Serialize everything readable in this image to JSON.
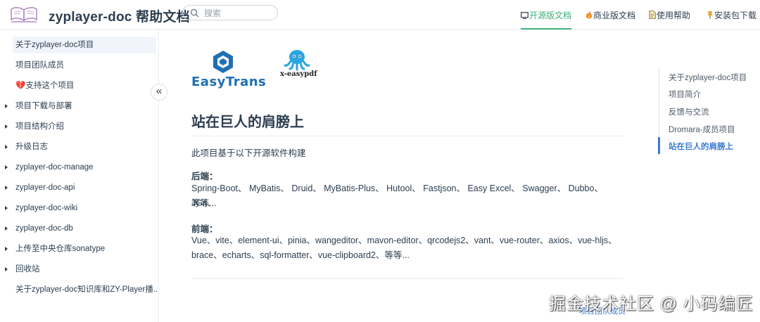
{
  "header": {
    "title": "zyplayer-doc 帮助文档",
    "search_placeholder": "搜索",
    "nav": [
      {
        "icon": "monitor-icon",
        "label": "开源版文档",
        "active": true
      },
      {
        "icon": "fire-icon",
        "label": "商业版文档",
        "active": false
      },
      {
        "icon": "document-icon",
        "label": "使用帮助",
        "active": false
      },
      {
        "icon": "pin-icon",
        "label": "安装包下载",
        "active": false
      }
    ]
  },
  "sidebar": {
    "items": [
      {
        "label": "关于zyplayer-doc项目",
        "active": true,
        "has_children": false
      },
      {
        "label": "项目团队成员",
        "active": false,
        "has_children": false
      },
      {
        "label": "💔支持这个项目",
        "active": false,
        "has_children": false
      },
      {
        "label": "项目下载与部署",
        "active": false,
        "has_children": true
      },
      {
        "label": "项目结构介绍",
        "active": false,
        "has_children": true
      },
      {
        "label": "升级日志",
        "active": false,
        "has_children": true
      },
      {
        "label": "zyplayer-doc-manage",
        "active": false,
        "has_children": true
      },
      {
        "label": "zyplayer-doc-api",
        "active": false,
        "has_children": true
      },
      {
        "label": "zyplayer-doc-wiki",
        "active": false,
        "has_children": true
      },
      {
        "label": "zyplayer-doc-db",
        "active": false,
        "has_children": true
      },
      {
        "label": "上传至中央仓库sonatype",
        "active": false,
        "has_children": true
      },
      {
        "label": "回收站",
        "active": false,
        "has_children": true
      },
      {
        "label": "关于zyplayer-doc知识库和ZY-Player播...",
        "active": false,
        "has_children": false
      }
    ],
    "collapse_label": "«"
  },
  "main": {
    "logos": {
      "easytrans": "EasyTrans",
      "easypdf": "x-easypdf"
    },
    "heading": "站在巨人的肩膀上",
    "intro": "此项目基于以下开源软件构建",
    "backend_label": "后端：",
    "backend_line1": "Spring-Boot、 MyBatis、 Druid、 MyBatis-Plus、 Hutool、 Fastjson、 Easy Excel、 Swagger、 Dubbo、 JGit、",
    "backend_line2": "等等...",
    "frontend_label": "前端：",
    "frontend_line1": "Vue、vite、element-ui、pinia、wangeditor、mavon-editor、qrcodejs2、vant、vue-router、axios、vue-hljs、",
    "frontend_line2": "brace、echarts、sql-formatter、vue-clipboard2、等等...",
    "footer_link": "项目团队成员"
  },
  "toc": {
    "items": [
      {
        "label": "关于zyplayer-doc项目",
        "active": false
      },
      {
        "label": "项目简介",
        "active": false
      },
      {
        "label": "反馈与交流",
        "active": false
      },
      {
        "label": "Dromara-成员项目",
        "active": false
      },
      {
        "label": "站在巨人的肩膀上",
        "active": true
      }
    ]
  },
  "watermark": "掘金技术社区 @ 小码编匠",
  "colors": {
    "accent_green": "#3eaf7c",
    "accent_blue": "#3a7bd5",
    "text": "#2c3e50",
    "easytrans_blue": "#1f6fb5"
  }
}
